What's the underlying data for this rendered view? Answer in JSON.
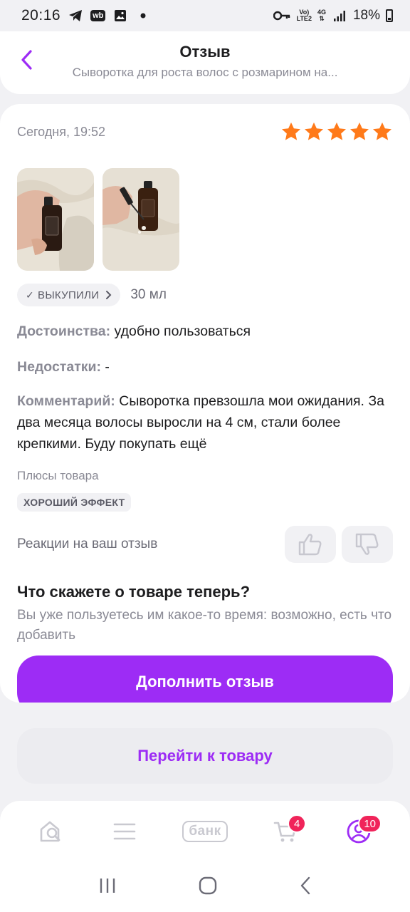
{
  "status_bar": {
    "time": "20:16",
    "wb_label": "wb",
    "signal_top": "Vo)",
    "signal_bottom": "LTE2",
    "network": "4G",
    "battery": "18%"
  },
  "header": {
    "title": "Отзыв",
    "subtitle": "Сыворотка для роста волос с розмарином на..."
  },
  "review": {
    "date": "Сегодня, 19:52",
    "rating": 5,
    "max_rating": 5,
    "star_color": "#ff7a1a",
    "bought_label": "ВЫКУПИЛИ",
    "volume": "30 мл",
    "pros_label": "Достоинства:",
    "pros_text": "удобно пользоваться",
    "cons_label": "Недостатки:",
    "cons_text": "-",
    "comment_label": "Комментарий:",
    "comment_text": "Сыворотка превзошла мои ожидания. За два месяца волосы выросли на 4 см, стали более крепкими. Буду покупать ещё",
    "plus_title": "Плюсы товара",
    "plus_tags": [
      "ХОРОШИЙ ЭФФЕКТ"
    ],
    "reactions_label": "Реакции на ваш отзыв"
  },
  "prompt": {
    "title": "Что скажете о товаре теперь?",
    "text": "Вы уже пользуетесь им какое-то время: возможно, есть что добавить",
    "button": "Дополнить отзыв"
  },
  "goto_button": "Перейти к товару",
  "bottom_nav": {
    "bank_label": "банк",
    "cart_badge": "4",
    "profile_badge": "10"
  },
  "colors": {
    "accent": "#9d2cf5",
    "badge": "#f0245a"
  }
}
